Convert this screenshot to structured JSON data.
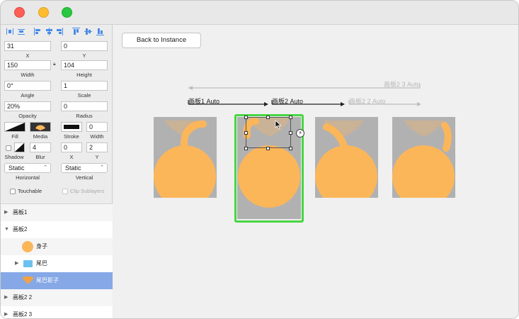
{
  "window": {
    "traffic_lights": [
      "close",
      "minimize",
      "zoom"
    ]
  },
  "inspector": {
    "x": {
      "value": "31",
      "label": "X"
    },
    "y": {
      "value": "0",
      "label": "Y"
    },
    "width": {
      "value": "150",
      "label": "Width"
    },
    "height": {
      "value": "104",
      "label": "Height"
    },
    "angle": {
      "value": "0°",
      "label": "Angle"
    },
    "scale": {
      "value": "1",
      "label": "Scale"
    },
    "opacity": {
      "value": "20%",
      "label": "Opacity"
    },
    "radius": {
      "value": "0",
      "label": "Radius"
    },
    "fill_label": "Fill",
    "media_label": "Media",
    "stroke_label": "Stroke",
    "stroke_width": {
      "value": "0",
      "label": "Width"
    },
    "shadow_label": "Shadow",
    "blur": {
      "value": "4",
      "label": "Blur"
    },
    "shadow_x": {
      "value": "0",
      "label": "X"
    },
    "shadow_y": {
      "value": "2",
      "label": "Y"
    },
    "horizontal": {
      "value": "Static",
      "label": "Horizontal"
    },
    "vertical": {
      "value": "Static",
      "label": "Vertical"
    },
    "touchable_label": "Touchable",
    "clip_sublayers_label": "Clip Sublayers"
  },
  "layers": [
    {
      "name": "画板1",
      "expanded": false,
      "indent": 0
    },
    {
      "name": "画板2",
      "expanded": true,
      "indent": 0
    },
    {
      "name": "身子",
      "indent": 1,
      "icon": "circle-layer-icon"
    },
    {
      "name": "尾巴",
      "indent": 1,
      "icon": "folder-icon",
      "expandable": true
    },
    {
      "name": "尾巴影子",
      "indent": 1,
      "icon": "shape-layer-icon",
      "selected": true
    },
    {
      "name": "画板2 2",
      "expanded": false,
      "indent": 0
    },
    {
      "name": "画板2 3",
      "expanded": false,
      "indent": 0
    }
  ],
  "canvas": {
    "back_button": "Back to Instance",
    "connections": [
      {
        "label": "画板1 Auto",
        "style": "dark"
      },
      {
        "label": "画板2 Auto",
        "style": "dark"
      },
      {
        "label": "画板2 2 Auto",
        "style": "light"
      },
      {
        "label": "画板2 3 Auto",
        "style": "light"
      }
    ],
    "artboards": [
      "画板1",
      "画板2",
      "画板2 2",
      "画板2 3"
    ],
    "selected_artboard_index": 1
  },
  "colors": {
    "artboard_bg": "#b1b1b1",
    "body_orange": "#fbb65a",
    "shadow_tan": "#d2b38e",
    "selection_green": "#47d643",
    "layer_selected": "#86a8e6"
  }
}
